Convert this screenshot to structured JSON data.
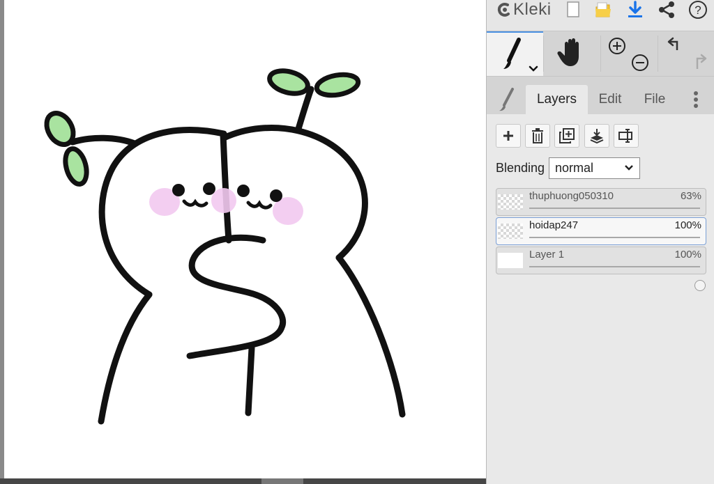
{
  "app": {
    "logo_text": "Kleki"
  },
  "top_bar": {
    "icons": [
      "new-image-icon",
      "open-folder-icon",
      "download-icon",
      "share-icon",
      "help-icon"
    ]
  },
  "tools": [
    "brush-tool",
    "hand-tool",
    "zoom-in-out",
    "undo-redo"
  ],
  "tabs": {
    "layers": "Layers",
    "edit": "Edit",
    "file": "File"
  },
  "layer_actions": [
    "add-layer",
    "delete-layer",
    "duplicate-layer",
    "merge-down",
    "rename-layer"
  ],
  "blending": {
    "label": "Blending",
    "value": "normal"
  },
  "layers": [
    {
      "name": "thuphuong050310",
      "opacity_label": "63%",
      "opacity": 0.63,
      "selected": false
    },
    {
      "name": "hoidap247",
      "opacity_label": "100%",
      "opacity": 1.0,
      "selected": true
    },
    {
      "name": "Layer 1",
      "opacity_label": "100%",
      "opacity": 1.0,
      "selected": false
    }
  ],
  "colors": {
    "accent": "#4a90e2",
    "panel": "#dddddd",
    "sprout_green": "#a9e3a0",
    "blush": "#f2c9f0"
  }
}
